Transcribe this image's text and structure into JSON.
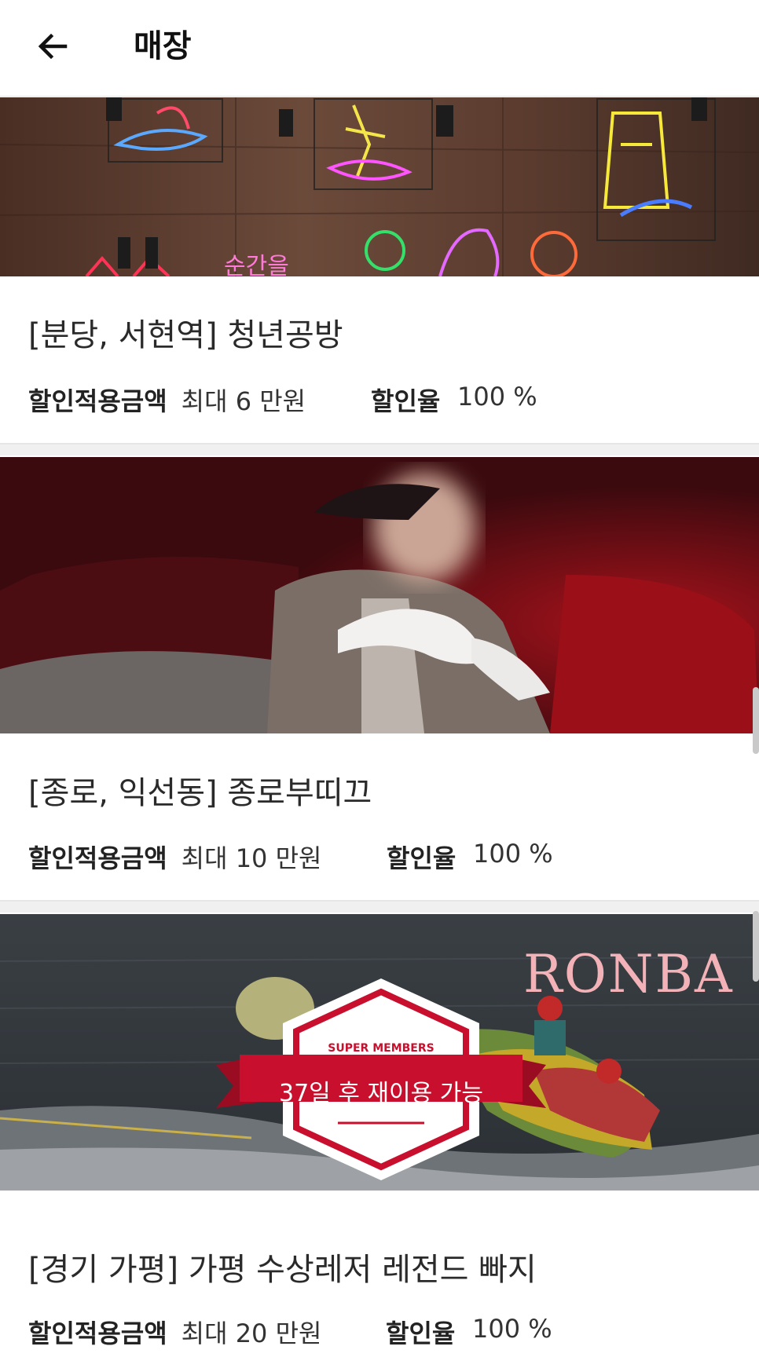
{
  "header": {
    "title": "매장",
    "back_icon": "arrow-left-icon"
  },
  "stores": [
    {
      "name": "[분당, 서현역] 청년공방",
      "discount_amount_label": "할인적용금액",
      "discount_amount_value": "최대 6 만원",
      "discount_rate_label": "할인율",
      "discount_rate_value": "100 %"
    },
    {
      "name": "[종로, 익선동] 종로부띠끄",
      "discount_amount_label": "할인적용금액",
      "discount_amount_value": "최대 10 만원",
      "discount_rate_label": "할인율",
      "discount_rate_value": "100 %"
    },
    {
      "name": "[경기 가평] 가평 수상레저 레전드 빠지",
      "discount_amount_label": "할인적용금액",
      "discount_amount_value": "최대 20 만원",
      "discount_rate_label": "할인율",
      "discount_rate_value": "100 %",
      "image_text": "RONBA",
      "badge": {
        "top_text": "SUPER MEMBERS",
        "main_text": "37일 후 재이용 가능"
      }
    }
  ],
  "colors": {
    "badge_red": "#c8102e",
    "ronba_pink": "#f2b2b7"
  }
}
